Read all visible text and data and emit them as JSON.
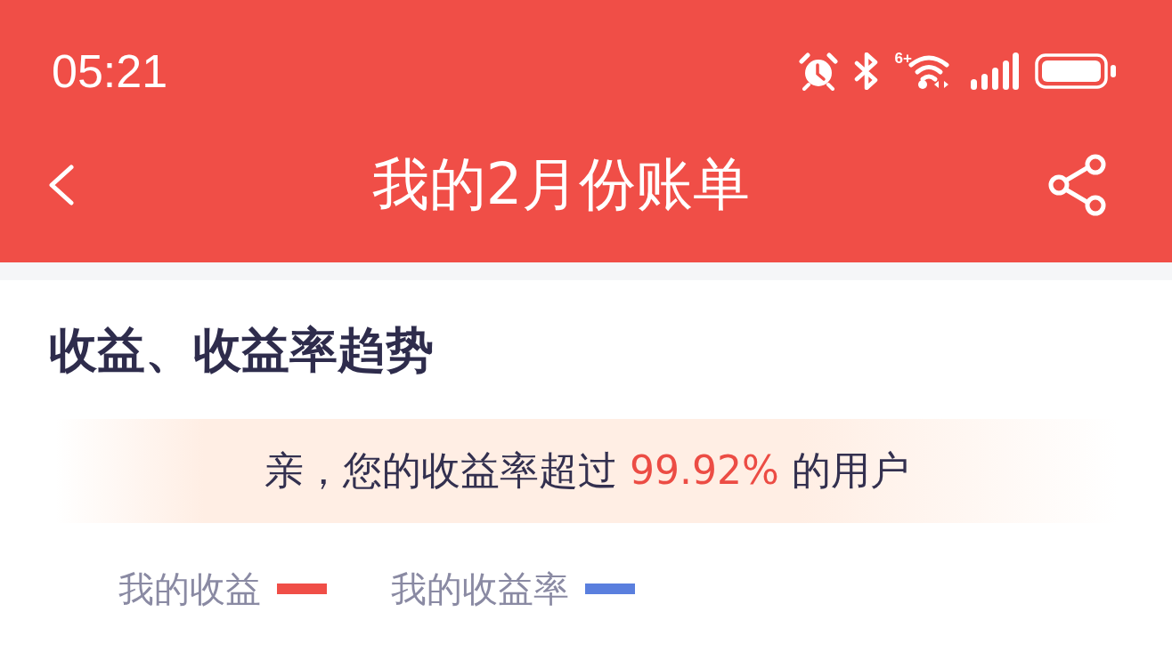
{
  "status_bar": {
    "time": "05:21",
    "wifi_badge": "6+"
  },
  "nav_bar": {
    "title": "我的2月份账单"
  },
  "section": {
    "heading": "收益、收益率趋势",
    "banner": {
      "text_before": "亲，您的收益率超过 ",
      "highlight": "99.92%",
      "text_after": " 的用户"
    },
    "legend": [
      {
        "label": "我的收益",
        "color": "#f04e47"
      },
      {
        "label": "我的收益率",
        "color": "#5a7fde"
      }
    ]
  }
}
